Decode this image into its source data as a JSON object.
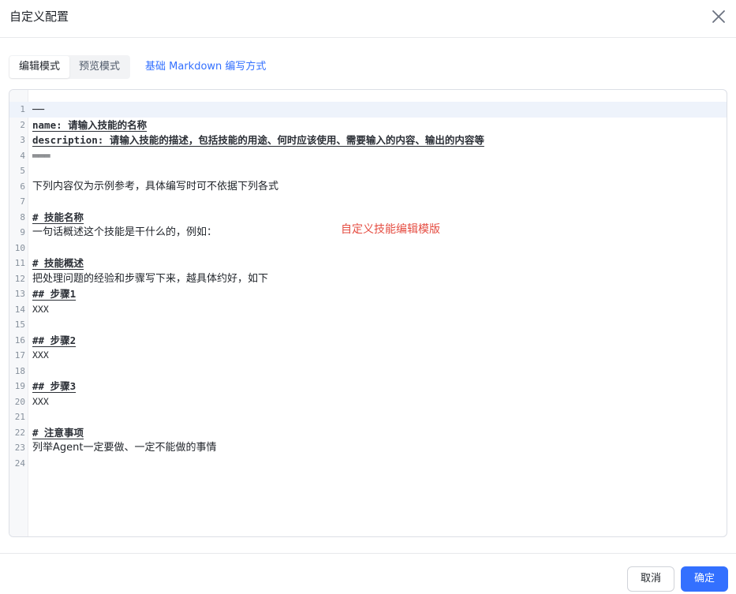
{
  "dialog": {
    "title": "自定义配置"
  },
  "tabs": [
    {
      "label": "编辑模式",
      "active": true
    },
    {
      "label": "预览模式",
      "active": false
    }
  ],
  "markdown_link": "基础 Markdown 编写方式",
  "editor": {
    "lines": [
      {
        "num": "1",
        "text": "──",
        "style": "rule"
      },
      {
        "num": "2",
        "text": "name: 请输入技能的名称",
        "style": "meta"
      },
      {
        "num": "3",
        "text": "description: 请输入技能的描述，包括技能的用途、何时应该使用、需要输入的内容、输出的内容等",
        "style": "meta"
      },
      {
        "num": "4",
        "text": "═══",
        "style": "rule"
      },
      {
        "num": "5",
        "text": "",
        "style": "plain"
      },
      {
        "num": "6",
        "text": "下列内容仅为示例参考，具体编写时可不依据下列各式",
        "style": "plain"
      },
      {
        "num": "7",
        "text": "",
        "style": "plain"
      },
      {
        "num": "8",
        "text": "# 技能名称",
        "style": "heading"
      },
      {
        "num": "9",
        "text": "一句话概述这个技能是干什么的，例如：",
        "style": "plain"
      },
      {
        "num": "10",
        "text": "",
        "style": "plain"
      },
      {
        "num": "11",
        "text": "# 技能概述",
        "style": "heading"
      },
      {
        "num": "12",
        "text": "把处理问题的经验和步骤写下来，越具体约好，如下",
        "style": "plain"
      },
      {
        "num": "13",
        "text": "## 步骤1",
        "style": "heading"
      },
      {
        "num": "14",
        "text": "XXX",
        "style": "mono"
      },
      {
        "num": "15",
        "text": "",
        "style": "plain"
      },
      {
        "num": "16",
        "text": "## 步骤2",
        "style": "heading"
      },
      {
        "num": "17",
        "text": "XXX",
        "style": "mono"
      },
      {
        "num": "18",
        "text": "",
        "style": "plain"
      },
      {
        "num": "19",
        "text": "## 步骤3",
        "style": "heading"
      },
      {
        "num": "20",
        "text": "XXX",
        "style": "mono"
      },
      {
        "num": "21",
        "text": "",
        "style": "plain"
      },
      {
        "num": "22",
        "text": "# 注意事项",
        "style": "heading"
      },
      {
        "num": "23",
        "text": "列举Agent一定要做、一定不能做的事情",
        "style": "plain"
      },
      {
        "num": "24",
        "text": "",
        "style": "plain"
      }
    ],
    "current_line": "1"
  },
  "annotation": "自定义技能编辑模版",
  "footer": {
    "cancel_label": "取消",
    "ok_label": "确定"
  },
  "colors": {
    "primary": "#3370ff",
    "annotation": "#e54d42",
    "current_line_bg": "#eef3fb"
  },
  "icons": {
    "close": "close-icon"
  }
}
